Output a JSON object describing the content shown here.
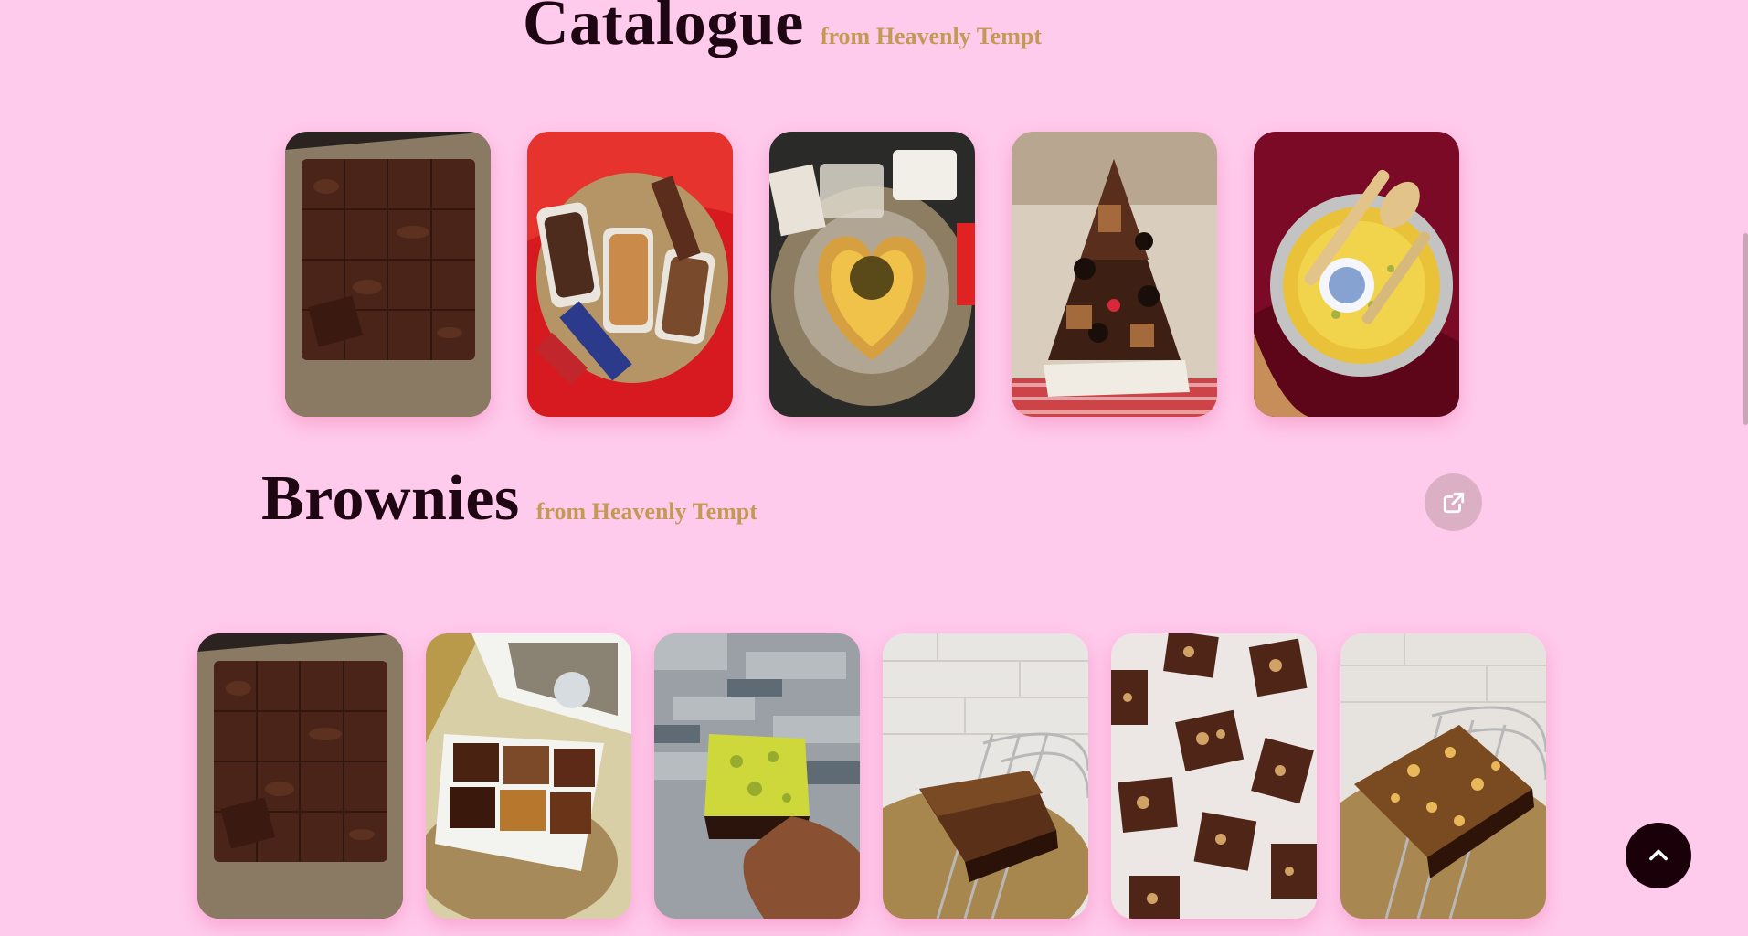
{
  "catalogue": {
    "title": "Catalogue",
    "subtitle": "from Heavenly Tempt",
    "items": [
      {
        "icon": "brownie-tray-photo"
      },
      {
        "icon": "dessert-platter-photo"
      },
      {
        "icon": "heart-cake-photo"
      },
      {
        "icon": "brownie-tower-photo"
      },
      {
        "icon": "pistachio-pie-photo"
      }
    ]
  },
  "brownies": {
    "title": "Brownies",
    "subtitle": "from Heavenly Tempt",
    "open_icon": "external-link-icon",
    "items": [
      {
        "icon": "brownie-tray-photo"
      },
      {
        "icon": "brownie-box-photo"
      },
      {
        "icon": "pistachio-brownie-photo"
      },
      {
        "icon": "brownie-slice-photo"
      },
      {
        "icon": "nut-brownies-photo"
      },
      {
        "icon": "hazelnut-brownie-photo"
      }
    ]
  },
  "scroll_top_icon": "chevron-up-icon",
  "colors": {
    "background": "#ffcbed",
    "title": "#1e0712",
    "subtitle": "#c39a54",
    "scroll_top_button": "#1a0109",
    "open_button": "#dcb0c4"
  }
}
